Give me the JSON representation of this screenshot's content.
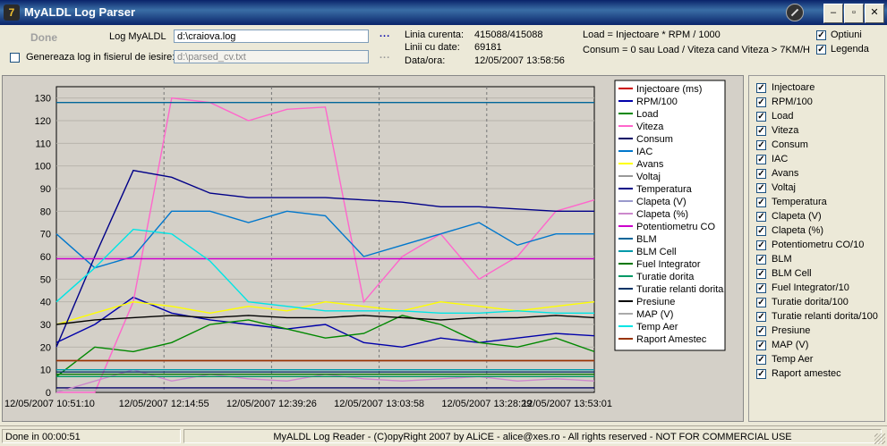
{
  "window": {
    "title": "MyALDL Log Parser",
    "minimize": "–",
    "maximize": "▫",
    "close": "✕"
  },
  "controls": {
    "done_label": "Done",
    "log_label": "Log MyALDL",
    "log_value": "d:\\craiova.log",
    "gen_label": "Genereaza log in fisierul de iesire:",
    "gen_checked": false,
    "out_value": "d:\\parsed_cv.txt",
    "dots1": "...",
    "dots2": "...",
    "linia_label": "Linia curenta:",
    "linia_value": "415088/415088",
    "linii_label": "Linii cu date:",
    "linii_value": "69181",
    "data_label": "Data/ora:",
    "data_value": "12/05/2007 13:58:56",
    "formula1": "Load = Injectoare * RPM / 1000",
    "formula2": "Consum = 0 sau Load / Viteza cand Viteza > 7KM/H",
    "optiuni_label": "Optiuni",
    "legenda_label": "Legenda"
  },
  "chart_data": {
    "type": "line",
    "ylim": [
      0,
      135
    ],
    "yticks": [
      "0",
      "10",
      "20",
      "30",
      "40",
      "50",
      "60",
      "70",
      "80",
      "90",
      "100",
      "110",
      "120",
      "130"
    ],
    "xticks": [
      "12/05/2007 10:51:10",
      "12/05/2007 12:14:55",
      "12/05/2007 12:39:26",
      "12/05/2007 13:03:58",
      "12/05/2007 13:28:29",
      "12/05/2007 13:53:01"
    ],
    "series": [
      {
        "name": "Injectoare (ms)",
        "color": "#cc0000",
        "values": [
          14,
          14,
          14,
          14,
          14,
          14,
          14,
          14,
          14,
          14
        ]
      },
      {
        "name": "RPM/100",
        "color": "#0000aa",
        "values": [
          22,
          30,
          42,
          35,
          32,
          30,
          28,
          30,
          22,
          20,
          24,
          22,
          24,
          26,
          25
        ]
      },
      {
        "name": "Load",
        "color": "#008800",
        "values": [
          7,
          20,
          18,
          22,
          30,
          32,
          28,
          24,
          26,
          34,
          30,
          22,
          20,
          24,
          18
        ]
      },
      {
        "name": "Viteza",
        "color": "#ff66cc",
        "values": [
          0,
          0,
          40,
          130,
          128,
          120,
          125,
          126,
          40,
          60,
          70,
          50,
          60,
          80,
          85
        ]
      },
      {
        "name": "Consum",
        "color": "#000066",
        "values": [
          2,
          2,
          2,
          2,
          2,
          2,
          2,
          2,
          2,
          2,
          2,
          2,
          2,
          2,
          2
        ]
      },
      {
        "name": "IAC",
        "color": "#0077cc",
        "values": [
          70,
          55,
          60,
          80,
          80,
          75,
          80,
          78,
          60,
          65,
          70,
          75,
          65,
          70,
          70
        ]
      },
      {
        "name": "Avans",
        "color": "#ffff00",
        "values": [
          30,
          35,
          40,
          38,
          35,
          38,
          36,
          40,
          38,
          36,
          40,
          38,
          36,
          38,
          40
        ]
      },
      {
        "name": "Voltaj",
        "color": "#999999",
        "values": [
          14,
          14,
          14,
          14,
          14,
          14,
          14,
          14,
          14,
          14,
          14,
          14,
          14,
          14,
          14
        ]
      },
      {
        "name": "Temperatura",
        "color": "#000088",
        "values": [
          20,
          60,
          98,
          95,
          88,
          86,
          86,
          86,
          85,
          84,
          82,
          82,
          81,
          80,
          80
        ]
      },
      {
        "name": "Clapeta (V)",
        "color": "#9999cc",
        "values": [
          1,
          1,
          1,
          1,
          1,
          1,
          1,
          1,
          1,
          1,
          1,
          1,
          1,
          1,
          1
        ]
      },
      {
        "name": "Clapeta (%)",
        "color": "#cc88cc",
        "values": [
          0,
          5,
          10,
          5,
          8,
          6,
          5,
          8,
          6,
          5,
          6,
          7,
          5,
          6,
          5
        ]
      },
      {
        "name": "Potentiometru CO",
        "color": "#cc00cc",
        "values": [
          59,
          59,
          59,
          59,
          59,
          59,
          59,
          59,
          59,
          59,
          59,
          59,
          59,
          59,
          59
        ]
      },
      {
        "name": "BLM",
        "color": "#006699",
        "values": [
          128,
          128,
          128,
          128,
          128,
          128,
          128,
          128,
          128,
          128,
          128,
          128,
          128,
          128,
          128
        ]
      },
      {
        "name": "BLM Cell",
        "color": "#0099aa",
        "values": [
          10,
          10,
          10,
          10,
          10,
          10,
          10,
          10,
          10,
          10,
          10,
          10,
          10,
          10,
          10
        ]
      },
      {
        "name": "Fuel Integrator",
        "color": "#007700",
        "values": [
          8,
          8,
          8,
          8,
          8,
          8,
          8,
          8,
          8,
          8,
          8,
          8,
          8,
          8,
          8
        ]
      },
      {
        "name": "Turatie dorita",
        "color": "#009966",
        "values": [
          7,
          7,
          7,
          7,
          7,
          7,
          7,
          7,
          7,
          7,
          7,
          7,
          7,
          7,
          7
        ]
      },
      {
        "name": "Turatie relanti dorita",
        "color": "#003366",
        "values": [
          9,
          9,
          9,
          9,
          9,
          9,
          9,
          9,
          9,
          9,
          9,
          9,
          9,
          9,
          9
        ]
      },
      {
        "name": "Presiune",
        "color": "#000000",
        "values": [
          30,
          32,
          33,
          34,
          33,
          34,
          33,
          33,
          34,
          33,
          32,
          33,
          33,
          34,
          33
        ]
      },
      {
        "name": "MAP (V)",
        "color": "#aaaaaa",
        "values": [
          1,
          1,
          1,
          1,
          1,
          1,
          1,
          1,
          1,
          1,
          1,
          1,
          1,
          1,
          1
        ]
      },
      {
        "name": "Temp Aer",
        "color": "#00e5e5",
        "values": [
          40,
          55,
          72,
          70,
          58,
          40,
          38,
          36,
          36,
          36,
          35,
          35,
          36,
          35,
          35
        ]
      },
      {
        "name": "Raport Amestec",
        "color": "#993300",
        "values": [
          14,
          14,
          14,
          14,
          14,
          14,
          14,
          14,
          14,
          14,
          14,
          14,
          14,
          14,
          14
        ]
      }
    ]
  },
  "sidebar": {
    "items": [
      {
        "label": "Injectoare",
        "checked": true
      },
      {
        "label": "RPM/100",
        "checked": true
      },
      {
        "label": "Load",
        "checked": true
      },
      {
        "label": "Viteza",
        "checked": true
      },
      {
        "label": "Consum",
        "checked": true
      },
      {
        "label": "IAC",
        "checked": true
      },
      {
        "label": "Avans",
        "checked": true
      },
      {
        "label": "Voltaj",
        "checked": true
      },
      {
        "label": "Temperatura",
        "checked": true
      },
      {
        "label": "Clapeta (V)",
        "checked": true
      },
      {
        "label": "Clapeta (%)",
        "checked": true
      },
      {
        "label": "Potentiometru CO/10",
        "checked": true
      },
      {
        "label": "BLM",
        "checked": true
      },
      {
        "label": "BLM Cell",
        "checked": true
      },
      {
        "label": "Fuel Integrator/10",
        "checked": true
      },
      {
        "label": "Turatie dorita/100",
        "checked": true
      },
      {
        "label": "Turatie relanti dorita/100",
        "checked": true
      },
      {
        "label": "Presiune",
        "checked": true
      },
      {
        "label": "MAP (V)",
        "checked": true
      },
      {
        "label": "Temp Aer",
        "checked": true
      },
      {
        "label": "Raport amestec",
        "checked": true
      }
    ]
  },
  "status": {
    "left": "Done in 00:00:51",
    "center": "MyALDL Log Reader - (C)opyRight 2007 by ALiCE - alice@xes.ro - All rights reserved - NOT FOR COMMERCIAL USE"
  }
}
